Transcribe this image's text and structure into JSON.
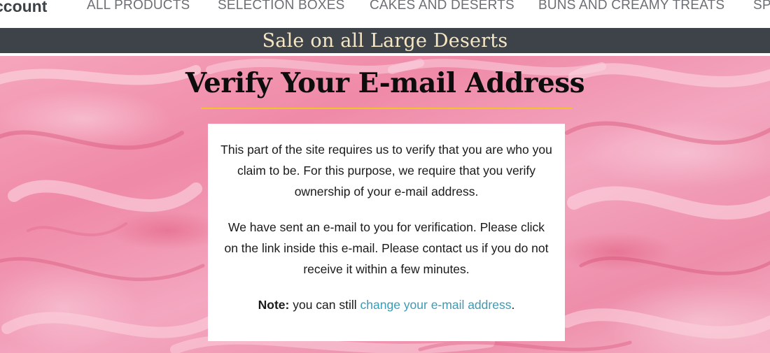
{
  "header": {
    "brand": "ccount",
    "nav": [
      "ALL PRODUCTS",
      "SELECTION BOXES",
      "CAKES AND DESERTS",
      "BUNS AND CREAMY TREATS",
      "SP"
    ]
  },
  "banner": {
    "text": "Sale on all Large Deserts"
  },
  "main": {
    "title": "Verify Your E-mail Address",
    "paragraph1": "This part of the site requires us to verify that you are who you claim to be. For this purpose, we require that you verify ownership of your e-mail address.",
    "paragraph2": "We have sent an e-mail to you for verification. Please click on the link inside this e-mail. Please contact us if you do not receive it within a few minutes.",
    "note_label": "Note:",
    "note_text": " you can still ",
    "note_link": "change your e-mail address",
    "note_end": "."
  },
  "colors": {
    "banner_bg": "#3d4349",
    "banner_text": "#f6e7c4",
    "accent_rule": "#f2c230",
    "link": "#3a9bb5"
  }
}
